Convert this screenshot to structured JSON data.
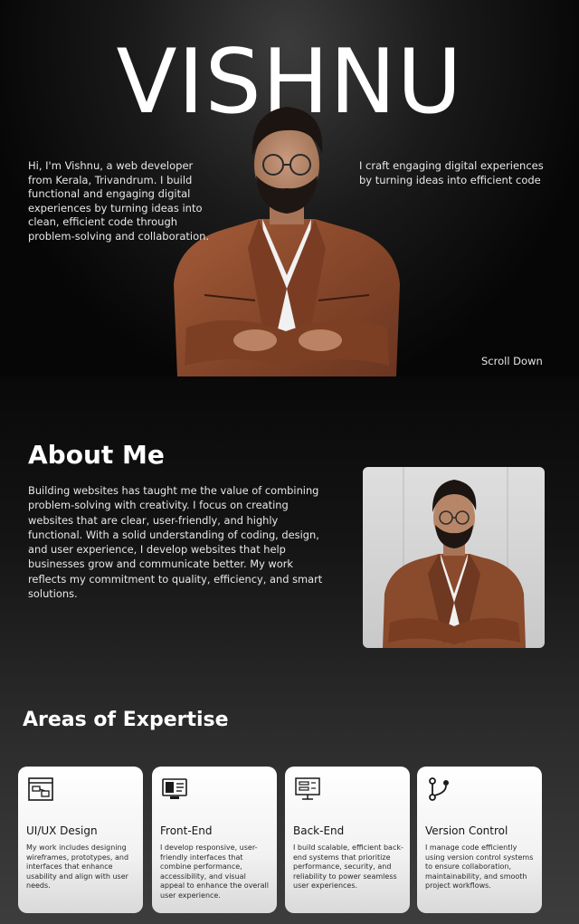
{
  "hero": {
    "name": "VISHNU",
    "intro": "Hi, I'm Vishnu, a web developer from Kerala, Trivandrum. I build functional and engaging digital experiences by turning ideas into clean, efficient code through problem-solving and collaboration.",
    "tagline": "I craft engaging digital experiences by turning ideas into efficient code",
    "scroll_label": "Scroll Down"
  },
  "about": {
    "title": "About Me",
    "body": "Building websites has taught me the value of combining problem-solving with creativity. I focus on creating websites that are clear, user-friendly, and highly functional. With a solid understanding of coding, design, and user experience, I develop websites that help businesses grow and communicate better. My work reflects my commitment to quality, efficiency, and smart solutions."
  },
  "expertise": {
    "title": "Areas of Expertise",
    "cards": [
      {
        "icon": "wireframe-icon",
        "title": "UI/UX Design",
        "description": "My work includes designing wireframes, prototypes, and interfaces that enhance usability and align with user needs."
      },
      {
        "icon": "monitor-code-icon",
        "title": "Front-End",
        "description": "I develop responsive, user-friendly interfaces that combine performance, accessibility, and visual appeal to enhance the overall user experience."
      },
      {
        "icon": "server-monitor-icon",
        "title": "Back-End",
        "description": "I build scalable, efficient back-end systems that prioritize performance, security, and reliability to power seamless user experiences."
      },
      {
        "icon": "git-branch-icon",
        "title": "Version Control",
        "description": "I manage code efficiently using version control systems to ensure collaboration, maintainability, and smooth project workflows."
      }
    ]
  },
  "colors": {
    "background": "#0b0b0b",
    "jacket": "#8a4a2c",
    "card": "#f4f4f4",
    "text": "#ffffff"
  }
}
